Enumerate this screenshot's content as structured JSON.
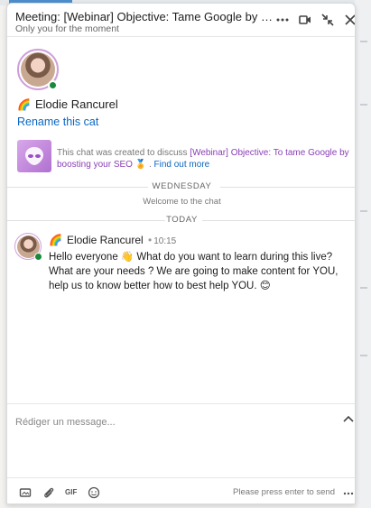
{
  "header": {
    "title": "Meeting: [Webinar] Objective: Tame Google by boo...",
    "subtitle": "Only you for the moment",
    "more_icon": "ellipsis-icon",
    "video_icon": "video-camera-icon",
    "minimize_icon": "collapse-icon",
    "close_icon": "close-icon"
  },
  "participant": {
    "emoji": "🌈",
    "name": "Elodie Rancurel",
    "status": "online",
    "status_color": "#1a8a3a"
  },
  "rename_label": "Rename this cat",
  "chat_info": {
    "prefix": "This chat was created to discuss ",
    "link_text": "[Webinar] Objective: To tame Google by boosting your SEO",
    "emoji": "🏅",
    "separator": " . ",
    "find_more": "Find out more"
  },
  "separators": {
    "day1": "WEDNESDAY",
    "welcome": "Welcome to the chat",
    "day2": "TODAY"
  },
  "message": {
    "author_emoji": "🌈",
    "author": "Elodie Rancurel",
    "dot": "•",
    "time": "10:15",
    "text_part1": "Hello everyone ",
    "wave_emoji": "👋",
    "text_part2": " What do you want to learn during this live? What are your needs ? We are going to make content for YOU, help us to know better how to best help YOU. ",
    "smile_emoji": "😊"
  },
  "composer": {
    "placeholder": "Rédiger un message...",
    "send_hint": "Please press enter to send",
    "gif_label": "GIF"
  },
  "colors": {
    "link_blue": "#0a66c2",
    "event_purple": "#8a3fb5",
    "avatar_ring": "#cf9fdc"
  }
}
